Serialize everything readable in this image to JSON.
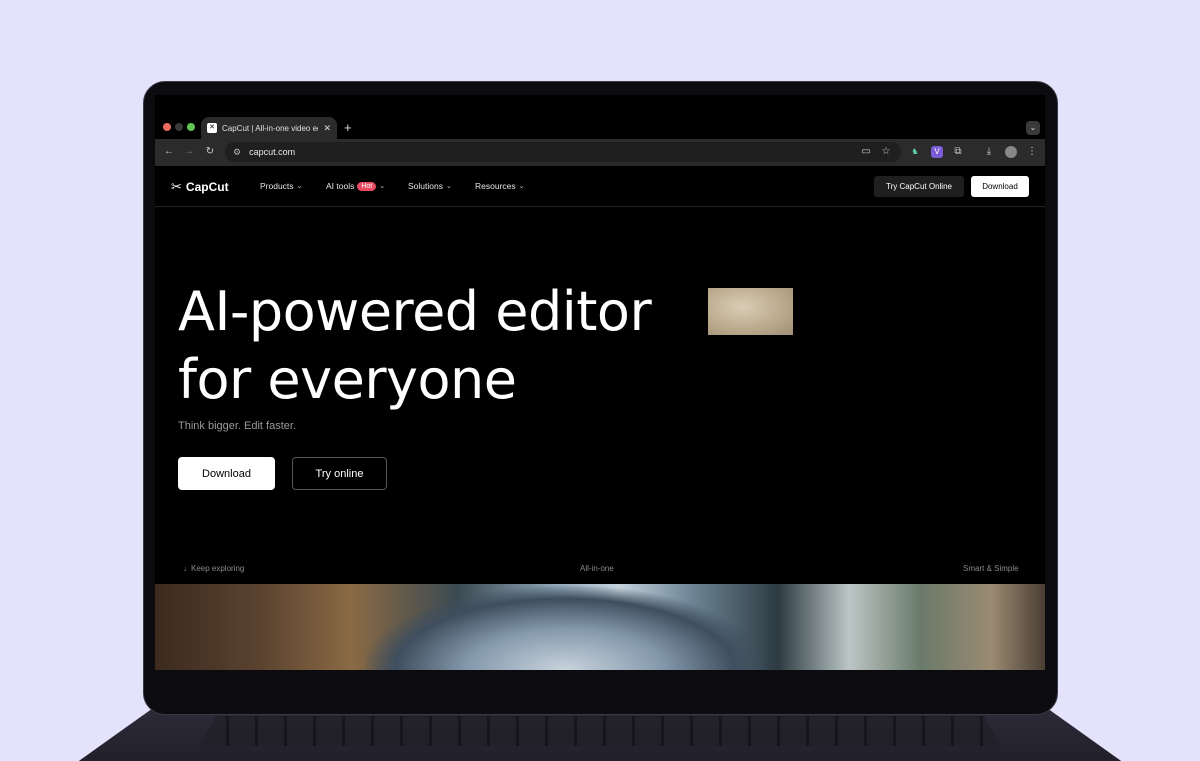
{
  "browser": {
    "tab_title": "CapCut | All-in-one video ed",
    "tab_favicon": "capcut-logo-icon",
    "new_tab_label": "+",
    "url": "capcut.com",
    "toolbar_icons": [
      "back-icon",
      "forward-icon",
      "reload-icon",
      "site-info-icon",
      "cast-icon",
      "star-icon",
      "extension-a-icon",
      "extension-b-icon",
      "extensions-icon",
      "download-icon",
      "profile-icon",
      "menu-icon"
    ]
  },
  "site": {
    "logo_text": "CapCut",
    "nav": {
      "products": "Products",
      "ai_tools": "AI tools",
      "hot_badge": "Hot",
      "solutions": "Solutions",
      "resources": "Resources"
    },
    "nav_try_button": "Try CapCut Online",
    "nav_download_button": "Download",
    "hero": {
      "line1": "AI-powered editor",
      "line2": "for everyone",
      "tagline": "Think bigger. Edit faster.",
      "download_button": "Download",
      "try_button": "Try online"
    },
    "strip": {
      "keep_exploring": "Keep exploring",
      "all_in_one": "All-in-one",
      "smart_simple": "Smart & Simple"
    }
  },
  "colors": {
    "background": "#e5e2fb",
    "hot_badge": "#e84a5f"
  }
}
